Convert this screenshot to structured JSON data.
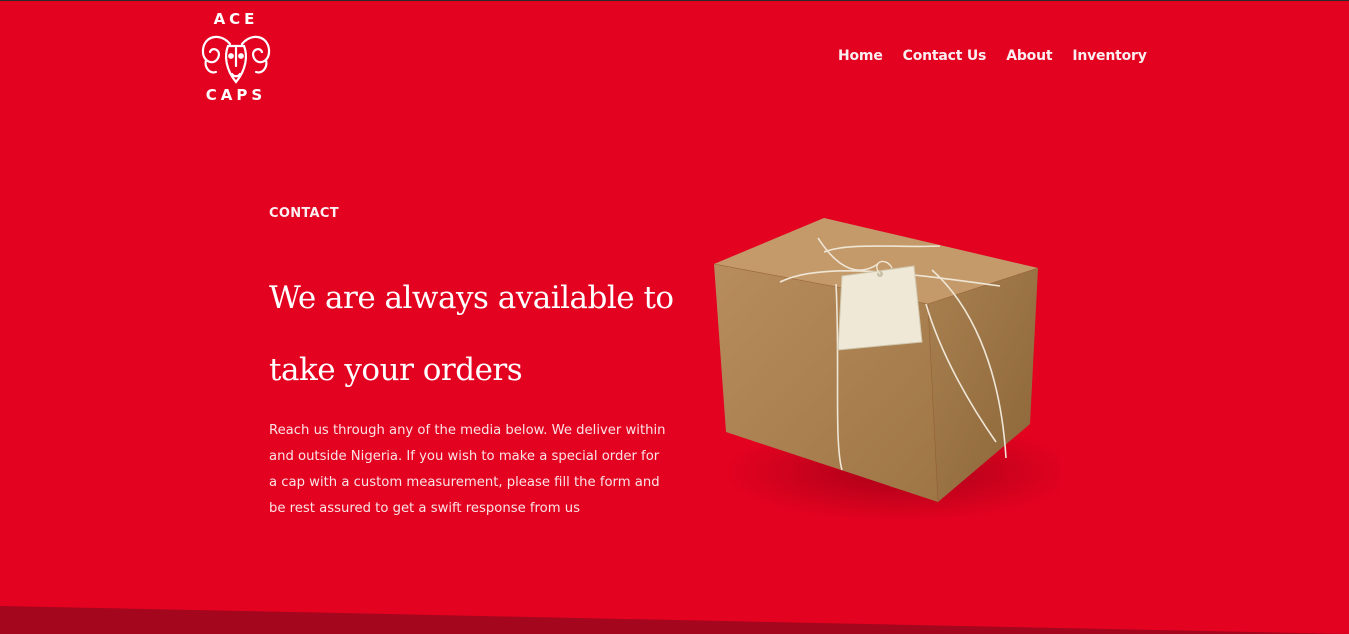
{
  "brand": {
    "logo_top": "ACE",
    "logo_bottom": "CAPS"
  },
  "nav": {
    "items": [
      {
        "label": "Home"
      },
      {
        "label": "Contact Us"
      },
      {
        "label": "About"
      },
      {
        "label": "Inventory"
      }
    ]
  },
  "hero": {
    "eyebrow": "CONTACT",
    "headline": "We are always available to take your orders",
    "body": "Reach us through any of the media below. We deliver within and outside Nigeria. If you wish to make a special order for a cap with a custom measurement, please fill the form and be rest assured to get a swift response from us"
  },
  "colors": {
    "background": "#e30220",
    "bottom_band": "#a3061d",
    "text": "#ffffff"
  }
}
